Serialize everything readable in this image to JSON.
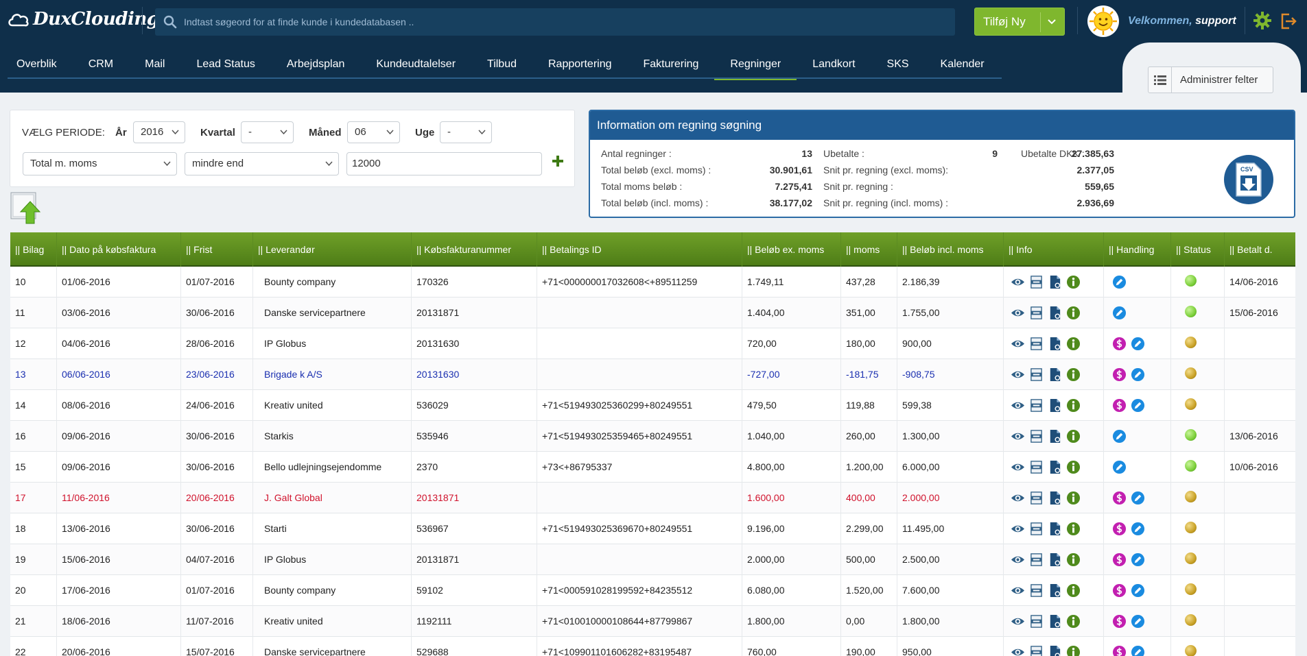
{
  "header": {
    "logo_text": "DuxClouding",
    "search_placeholder": "Indtast søgeord for at finde kunde i kundedatabasen ..",
    "add_new_label": "Tilføj Ny",
    "welcome_prefix": "Velkommen,",
    "welcome_user": "support"
  },
  "nav": {
    "items": [
      "Overblik",
      "CRM",
      "Mail",
      "Lead Status",
      "Arbejdsplan",
      "Kundeudtalelser",
      "Tilbud",
      "Rapportering",
      "Fakturering",
      "Regninger",
      "Landkort",
      "SKS",
      "Kalender"
    ],
    "active": "Regninger",
    "admin_button": "Administrer felter"
  },
  "filter": {
    "period_label": "VÆLG PERIODE:",
    "year_label": "År",
    "year_value": "2016",
    "quarter_label": "Kvartal",
    "quarter_value": "-",
    "month_label": "Måned",
    "month_value": "06",
    "week_label": "Uge",
    "week_value": "-",
    "field_value": "Total m. moms",
    "operator_value": "mindre end",
    "amount_value": "12000"
  },
  "info": {
    "title": "Information om regning søgning",
    "stats": [
      {
        "label": "Antal regninger :",
        "value": "13"
      },
      {
        "label": "Total beløb (excl. moms) :",
        "value": "30.901,61"
      },
      {
        "label": "Total moms beløb :",
        "value": "7.275,41"
      },
      {
        "label": "Total beløb (incl. moms) :",
        "value": "38.177,02"
      },
      {
        "label": "Ubetalte :",
        "value": "9"
      },
      {
        "label": "Snit pr. regning (excl. moms):",
        "value": "2.377,05"
      },
      {
        "label": "Snit pr. regning :",
        "value": "559,65"
      },
      {
        "label": "Snit pr. regning (incl. moms) :",
        "value": "2.936,69"
      },
      {
        "label": "Ubetalte DKK :",
        "value": "27.385,63"
      }
    ],
    "csv_label": "CSV"
  },
  "table": {
    "columns": [
      "|| Bilag",
      "|| Dato på købsfaktura",
      "|| Frist",
      "|| Leverandør",
      "|| Købsfakturanummer",
      "|| Betalings ID",
      "|| Beløb ex. moms",
      "|| moms",
      "|| Beløb incl. moms",
      "|| Info",
      "|| Handling",
      "|| Status",
      "|| Betalt d."
    ],
    "rows": [
      {
        "bilag": "10",
        "dato": "01/06-2016",
        "frist": "01/07-2016",
        "leverandor": "Bounty company",
        "nummer": "170326",
        "betalings_id": "+71<000000017032608<+89511259",
        "ex_moms": "1.749,11",
        "moms": "437,28",
        "incl_moms": "2.186,39",
        "handling": "edit",
        "status": "green",
        "betalt": "14/06-2016",
        "style": ""
      },
      {
        "bilag": "11",
        "dato": "03/06-2016",
        "frist": "30/06-2016",
        "leverandor": "Danske servicepartnere",
        "nummer": "20131871",
        "betalings_id": "",
        "ex_moms": "1.404,00",
        "moms": "351,00",
        "incl_moms": "1.755,00",
        "handling": "edit",
        "status": "green",
        "betalt": "15/06-2016",
        "style": ""
      },
      {
        "bilag": "12",
        "dato": "04/06-2016",
        "frist": "28/06-2016",
        "leverandor": "IP Globus",
        "nummer": "20131630",
        "betalings_id": "",
        "ex_moms": "720,00",
        "moms": "180,00",
        "incl_moms": "900,00",
        "handling": "pay-edit",
        "status": "yellow",
        "betalt": "",
        "style": ""
      },
      {
        "bilag": "13",
        "dato": "06/06-2016",
        "frist": "23/06-2016",
        "leverandor": "Brigade k A/S",
        "nummer": "20131630",
        "betalings_id": "",
        "ex_moms": "-727,00",
        "moms": "-181,75",
        "incl_moms": "-908,75",
        "handling": "pay-edit",
        "status": "yellow",
        "betalt": "",
        "style": "blue"
      },
      {
        "bilag": "14",
        "dato": "08/06-2016",
        "frist": "24/06-2016",
        "leverandor": "Kreativ united",
        "nummer": "536029",
        "betalings_id": "+71<519493025360299+80249551",
        "ex_moms": "479,50",
        "moms": "119,88",
        "incl_moms": "599,38",
        "handling": "pay-edit",
        "status": "yellow",
        "betalt": "",
        "style": ""
      },
      {
        "bilag": "16",
        "dato": "09/06-2016",
        "frist": "30/06-2016",
        "leverandor": "Starkis",
        "nummer": "535946",
        "betalings_id": "+71<519493025359465+80249551",
        "ex_moms": "1.040,00",
        "moms": "260,00",
        "incl_moms": "1.300,00",
        "handling": "edit",
        "status": "green",
        "betalt": "13/06-2016",
        "style": ""
      },
      {
        "bilag": "15",
        "dato": "09/06-2016",
        "frist": "30/06-2016",
        "leverandor": "Bello udlejningsejendomme",
        "nummer": "2370",
        "betalings_id": "+73<+86795337",
        "ex_moms": "4.800,00",
        "moms": "1.200,00",
        "incl_moms": "6.000,00",
        "handling": "edit",
        "status": "green",
        "betalt": "10/06-2016",
        "style": ""
      },
      {
        "bilag": "17",
        "dato": "11/06-2016",
        "frist": "20/06-2016",
        "leverandor": "J. Galt Global",
        "nummer": "20131871",
        "betalings_id": "",
        "ex_moms": "1.600,00",
        "moms": "400,00",
        "incl_moms": "2.000,00",
        "handling": "pay-edit",
        "status": "yellow",
        "betalt": "",
        "style": "red"
      },
      {
        "bilag": "18",
        "dato": "13/06-2016",
        "frist": "30/06-2016",
        "leverandor": "Starti",
        "nummer": "536967",
        "betalings_id": "+71<519493025369670+80249551",
        "ex_moms": "9.196,00",
        "moms": "2.299,00",
        "incl_moms": "11.495,00",
        "handling": "pay-edit",
        "status": "yellow",
        "betalt": "",
        "style": ""
      },
      {
        "bilag": "19",
        "dato": "15/06-2016",
        "frist": "04/07-2016",
        "leverandor": "IP Globus",
        "nummer": "20131871",
        "betalings_id": "",
        "ex_moms": "2.000,00",
        "moms": "500,00",
        "incl_moms": "2.500,00",
        "handling": "pay-edit",
        "status": "yellow",
        "betalt": "",
        "style": ""
      },
      {
        "bilag": "20",
        "dato": "17/06-2016",
        "frist": "01/07-2016",
        "leverandor": "Bounty company",
        "nummer": "59102",
        "betalings_id": "+71<000591028199592+84235512",
        "ex_moms": "6.080,00",
        "moms": "1.520,00",
        "incl_moms": "7.600,00",
        "handling": "pay-edit",
        "status": "yellow",
        "betalt": "",
        "style": ""
      },
      {
        "bilag": "21",
        "dato": "18/06-2016",
        "frist": "11/07-2016",
        "leverandor": "Kreativ united",
        "nummer": "1192111",
        "betalings_id": "+71<010010000108644+87799867",
        "ex_moms": "1.800,00",
        "moms": "0,00",
        "incl_moms": "1.800,00",
        "handling": "pay-edit",
        "status": "yellow",
        "betalt": "",
        "style": ""
      },
      {
        "bilag": "22",
        "dato": "20/06-2016",
        "frist": "15/07-2016",
        "leverandor": "Danske servicepartnere",
        "nummer": "529688",
        "betalings_id": "+71<109901101606282+83195487",
        "ex_moms": "760,00",
        "moms": "190,00",
        "incl_moms": "950,00",
        "handling": "pay-edit",
        "status": "yellow",
        "betalt": "",
        "style": ""
      }
    ]
  },
  "colors": {
    "nav_bg": "#0f2f4a",
    "accent_green": "#7fb72e",
    "header_blue": "#1f5b93",
    "status_green": "#7ccf3a",
    "status_yellow": "#c9a227",
    "row_blue": "#1a2fb0",
    "row_red": "#d0122c"
  }
}
